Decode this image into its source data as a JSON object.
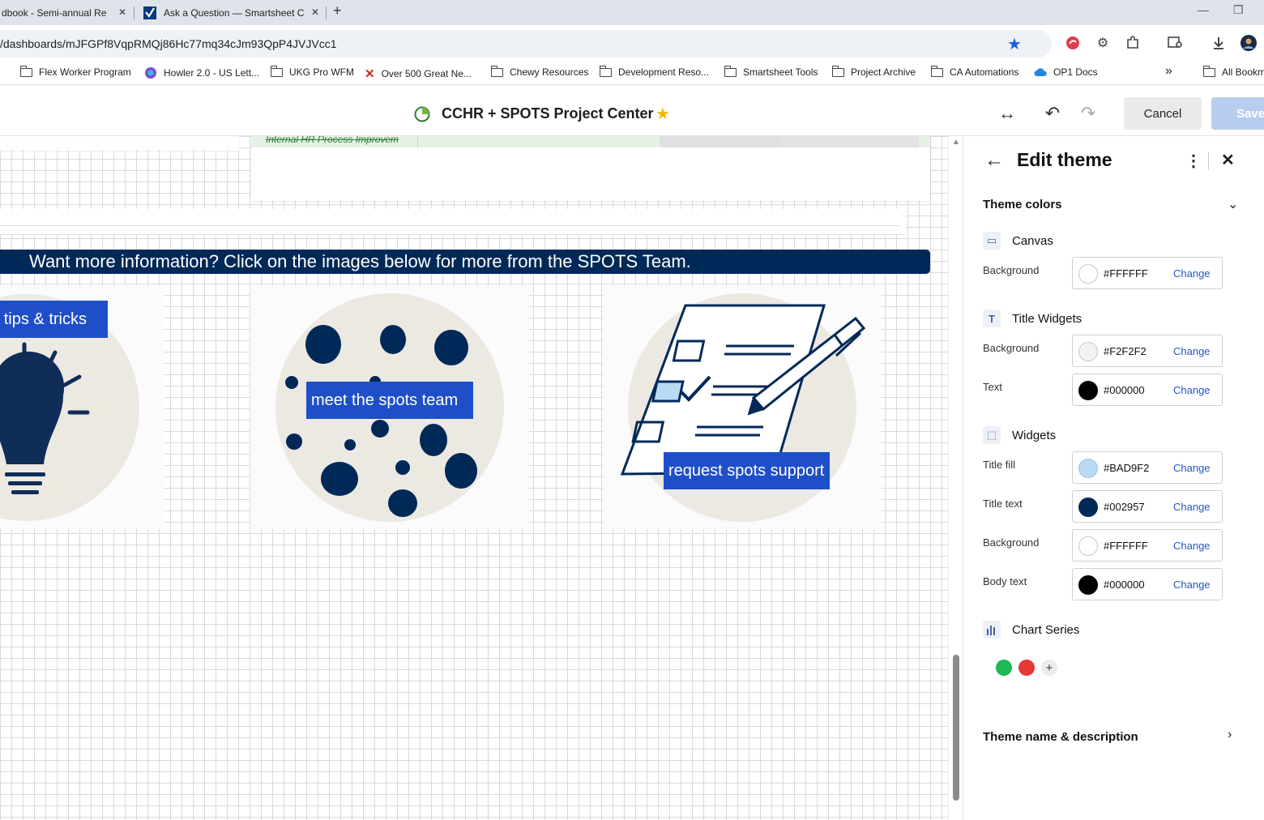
{
  "browser": {
    "tabs": [
      {
        "title": "dbook - Semi-annual Re",
        "close": "✕"
      },
      {
        "title": "Ask a Question — Smartsheet C",
        "close": "✕"
      }
    ],
    "new_tab": "+",
    "url": "/dashboards/mJFGPf8VqpRMQj86Hc77mq34cJm93QpP4JVJVcc1",
    "bookmarks": [
      "Flex Worker Program",
      "Howler 2.0 - US Lett...",
      "UKG Pro WFM",
      "Over 500 Great Ne...",
      "Chewy Resources",
      "Development Reso...",
      "Smartsheet Tools",
      "Project Archive",
      "CA Automations",
      "OP1 Docs",
      "All Bookm"
    ],
    "bookmarks_overflow": "»"
  },
  "header": {
    "dashboard_title": "CCHR + SPOTS Project Center",
    "cancel_label": "Cancel",
    "save_label": "Save"
  },
  "canvas": {
    "grid_row_text": "Internal HR Process Improvem",
    "banner_text": "Want more information? Click on the images below for more from the SPOTS Team.",
    "cards": [
      {
        "label": "tips & tricks"
      },
      {
        "label": "meet the spots team"
      },
      {
        "label": "request spots support"
      }
    ]
  },
  "panel": {
    "title": "Edit theme",
    "theme_colors_heading": "Theme colors",
    "groups": {
      "canvas": {
        "heading": "Canvas",
        "rows": [
          {
            "label": "Background",
            "hex": "#FFFFFF",
            "change": "Change"
          }
        ]
      },
      "title_widgets": {
        "heading": "Title Widgets",
        "rows": [
          {
            "label": "Background",
            "hex": "#F2F2F2",
            "change": "Change"
          },
          {
            "label": "Text",
            "hex": "#000000",
            "change": "Change"
          }
        ]
      },
      "widgets": {
        "heading": "Widgets",
        "rows": [
          {
            "label": "Title fill",
            "hex": "#BAD9F2",
            "change": "Change"
          },
          {
            "label": "Title text",
            "hex": "#002957",
            "change": "Change"
          },
          {
            "label": "Background",
            "hex": "#FFFFFF",
            "change": "Change"
          },
          {
            "label": "Body text",
            "hex": "#000000",
            "change": "Change"
          }
        ]
      },
      "chart_series": {
        "heading": "Chart Series",
        "colors": [
          "#1db954",
          "#e53935"
        ],
        "add": "+"
      }
    },
    "theme_name_heading": "Theme name & description"
  },
  "colors": {
    "navy": "#002957",
    "label_blue": "#1f4fc8",
    "link_blue": "#2557c7",
    "save_disabled": "#b7cdef"
  }
}
